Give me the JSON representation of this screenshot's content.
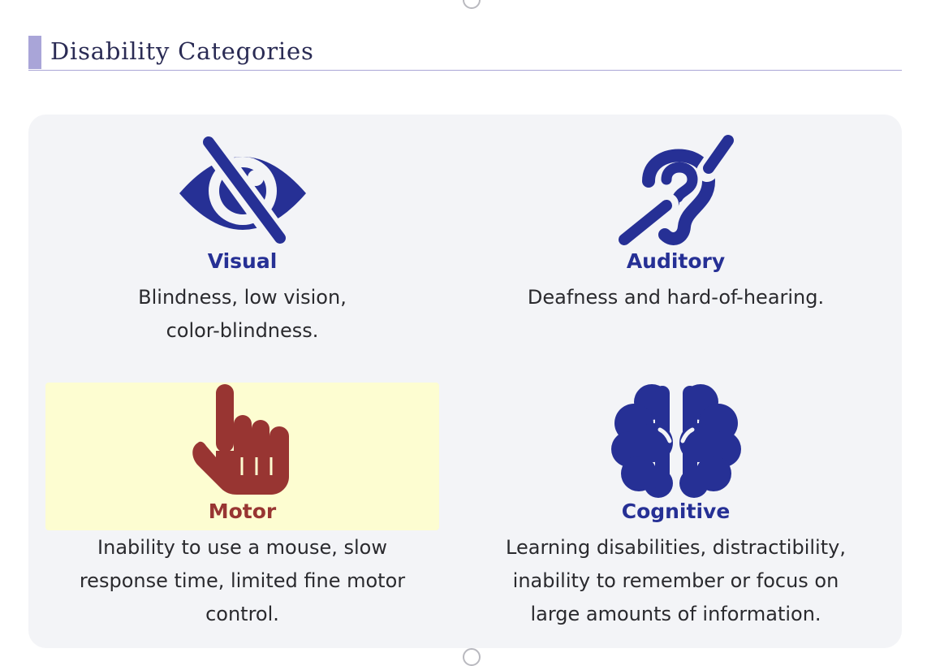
{
  "section": {
    "title": "Disability Categories"
  },
  "colors": {
    "accent_bar": "#a9a5d8",
    "panel_background": "#f3f4f7",
    "icon_blue": "#263095",
    "motor_red": "#983532",
    "motor_highlight": "#fdfdd1"
  },
  "categories": [
    {
      "title": "Visual",
      "icon": "eye-slash-icon",
      "description_lines": [
        "Blindness, low vision,",
        "color-blindness."
      ]
    },
    {
      "title": "Auditory",
      "icon": "deaf-ear-icon",
      "description_lines": [
        "Deafness and hard-of-hearing."
      ]
    },
    {
      "title": "Motor",
      "icon": "pointing-hand-icon",
      "description_lines": [
        "Inability to use a mouse, slow",
        "response time, limited fine motor",
        "control."
      ]
    },
    {
      "title": "Cognitive",
      "icon": "brain-icon",
      "description_lines": [
        "Learning disabilities, distractibility,",
        "inability to remember or focus on",
        "large amounts of information."
      ]
    }
  ]
}
